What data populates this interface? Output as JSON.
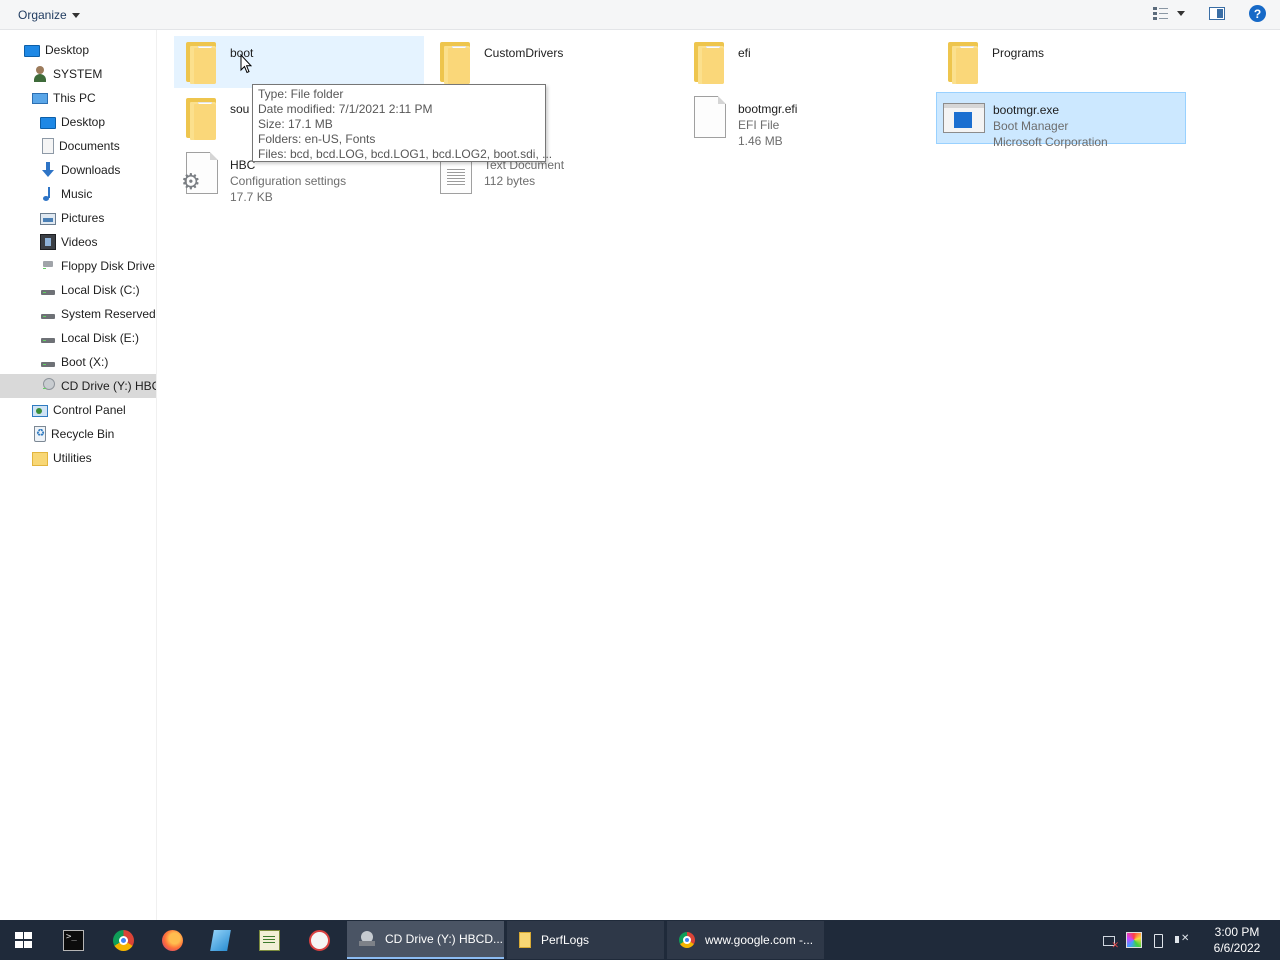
{
  "toolbar": {
    "organize_label": "Organize"
  },
  "nav": {
    "items": [
      {
        "label": "Desktop",
        "icon": "desktop-icon"
      },
      {
        "label": "SYSTEM",
        "icon": "user-icon"
      },
      {
        "label": "This PC",
        "icon": "pc-icon"
      },
      {
        "label": "Desktop",
        "icon": "desktop-icon"
      },
      {
        "label": "Documents",
        "icon": "documents-icon"
      },
      {
        "label": "Downloads",
        "icon": "downloads-icon"
      },
      {
        "label": "Music",
        "icon": "music-icon"
      },
      {
        "label": "Pictures",
        "icon": "pictures-icon"
      },
      {
        "label": "Videos",
        "icon": "videos-icon"
      },
      {
        "label": "Floppy Disk Drive",
        "icon": "floppy-drive-icon"
      },
      {
        "label": "Local Disk (C:)",
        "icon": "drive-icon"
      },
      {
        "label": "System Reserved (",
        "icon": "drive-icon"
      },
      {
        "label": "Local Disk (E:)",
        "icon": "drive-icon"
      },
      {
        "label": "Boot (X:)",
        "icon": "drive-icon"
      },
      {
        "label": "CD Drive (Y:) HBC",
        "icon": "cd-drive-icon"
      },
      {
        "label": "Control Panel",
        "icon": "control-panel-icon"
      },
      {
        "label": "Recycle Bin",
        "icon": "recycle-bin-icon"
      },
      {
        "label": "Utilities",
        "icon": "folder-icon"
      }
    ]
  },
  "files": [
    {
      "name": "boot",
      "type": "",
      "size": "",
      "icon": "folder-icon"
    },
    {
      "name": "CustomDrivers",
      "type": "",
      "size": "",
      "icon": "folder-icon"
    },
    {
      "name": "efi",
      "type": "",
      "size": "",
      "icon": "folder-icon"
    },
    {
      "name": "Programs",
      "type": "",
      "size": "",
      "icon": "folder-icon"
    },
    {
      "name": "sou",
      "type": "",
      "size": "",
      "icon": "folder-icon"
    },
    {
      "name": "bootmgr.efi",
      "type": "EFI File",
      "size": "1.46 MB",
      "icon": "file-icon"
    },
    {
      "name": "bootmgr.exe",
      "type": "Boot Manager",
      "size": "Microsoft Corporation",
      "icon": "exe-icon"
    },
    {
      "name": "HBC",
      "type": "Configuration settings",
      "size": "17.7 KB",
      "icon": "settings-file-icon"
    },
    {
      "name": "",
      "type": "Text Document",
      "size": "112 bytes",
      "icon": "text-file-icon"
    }
  ],
  "tooltip": {
    "type": "Type: File folder",
    "modified": "Date modified: 7/1/2021 2:11 PM",
    "size": "Size: 17.1 MB",
    "folders": "Folders: en-US, Fonts",
    "files": "Files: bcd, bcd.LOG, bcd.LOG1, bcd.LOG2, boot.sdi, ..."
  },
  "taskbar": {
    "pinned": [
      "cmd-icon",
      "chrome-icon",
      "firefox-icon",
      "notepad-plus-icon",
      "notepad-icon",
      "tool-icon"
    ],
    "buttons": [
      {
        "label": "CD Drive (Y:) HBCD...",
        "icon": "cd-drive-icon"
      },
      {
        "label": "PerfLogs",
        "icon": "folder-icon"
      },
      {
        "label": "www.google.com -...",
        "icon": "chrome-icon"
      }
    ],
    "time": "3:00 PM",
    "date": "6/6/2022"
  }
}
